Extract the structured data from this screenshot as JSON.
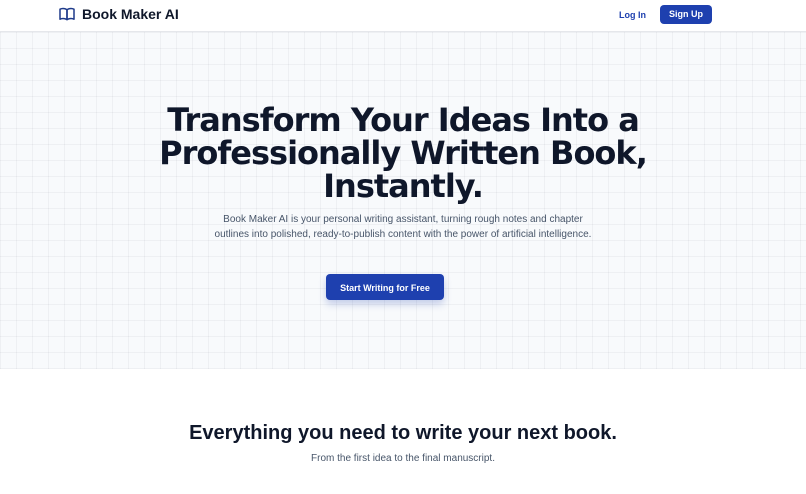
{
  "header": {
    "brand_name": "Book Maker AI",
    "brand_icon": "book-open-icon",
    "login_label": "Log In",
    "signup_label": "Sign Up"
  },
  "hero": {
    "title_line1": "Transform Your Ideas Into a",
    "title_line2": "Professionally Written Book,",
    "title_line3": "Instantly.",
    "subtitle": "Book Maker AI is your personal writing assistant, turning rough notes and chapter outlines into polished, ready-to-publish content with the power of artificial intelligence.",
    "cta_label": "Start Writing for Free"
  },
  "features": {
    "title": "Everything you need to write your next book.",
    "subtitle": "From the first idea to the final manuscript."
  },
  "colors": {
    "accent": "#1e40af",
    "text_dark": "#0f172a",
    "text_muted": "#475569",
    "hero_bg": "#f8fafc"
  }
}
